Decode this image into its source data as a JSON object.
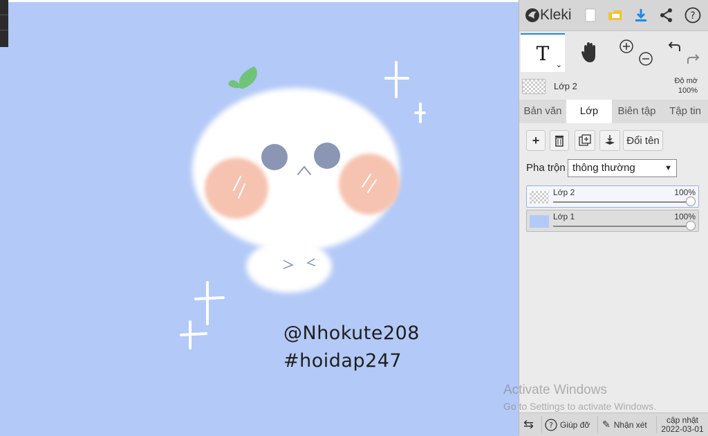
{
  "canvas": {
    "background_color": "#b3c9f7",
    "signature_line1": "@Nhokute208",
    "signature_line2": "#hoidap247"
  },
  "app": {
    "name": "Kleki",
    "toolbar_icons": [
      "new-file-icon",
      "open-folder-icon",
      "download-icon",
      "share-icon",
      "help-icon"
    ]
  },
  "tools": {
    "active": "text",
    "items": [
      "text-tool-icon",
      "hand-tool-icon",
      "zoom-in-icon",
      "zoom-out-icon",
      "undo-icon",
      "redo-icon"
    ]
  },
  "layer_header": {
    "name": "Lớp 2",
    "opacity_label": "Độ mờ",
    "opacity_value": "100%"
  },
  "tabs": [
    {
      "label": "Bản văn",
      "active": false
    },
    {
      "label": "Lớp",
      "active": true
    },
    {
      "label": "Biên tập",
      "active": false
    },
    {
      "label": "Tập tin",
      "active": false
    }
  ],
  "layer_panel": {
    "rename_label": "Đổi tên",
    "blend_label": "Pha trộn",
    "blend_value": "thông thường",
    "layers": [
      {
        "name": "Lớp 2",
        "opacity": "100%",
        "selected": true,
        "thumb": "checker"
      },
      {
        "name": "Lớp 1",
        "opacity": "100%",
        "selected": false,
        "thumb": "#b3c9f7"
      }
    ]
  },
  "bottom_bar": {
    "help_label": "Giúp đỡ",
    "feedback_label": "Nhận xét",
    "update_label": "cập nhật",
    "update_date": "2022-03-01"
  },
  "watermark": {
    "line1": "Activate Windows",
    "line2": "Go to Settings to activate Windows."
  },
  "colors": {
    "accent_blue": "#1e88e5",
    "folder_yellow": "#f2c230",
    "face_white": "#ffffff",
    "blush": "#f6c3b1",
    "eyes": "#8a96b4",
    "sprout": "#6fc47a"
  }
}
